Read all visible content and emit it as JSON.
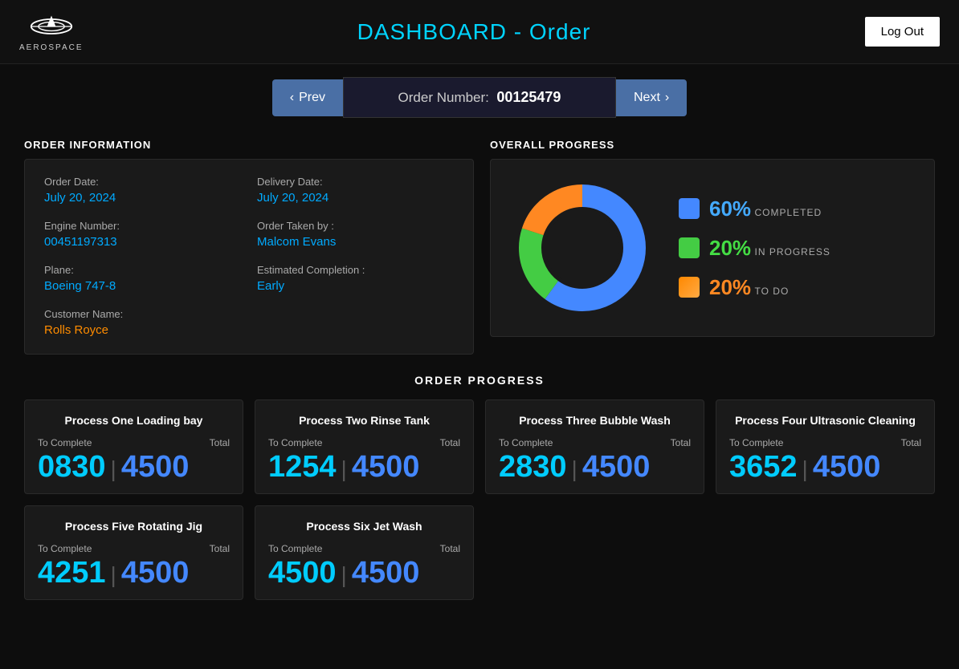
{
  "header": {
    "title": "DASHBOARD - Order",
    "logo_text": "AEROSPACE",
    "logout_label": "Log Out"
  },
  "nav": {
    "prev_label": "Prev",
    "next_label": "Next",
    "order_number_prefix": "Order Number:",
    "order_number": "00125479"
  },
  "order_info": {
    "section_title": "ORDER INFORMATION",
    "order_date_label": "Order Date:",
    "order_date_value": "July 20, 2024",
    "delivery_date_label": "Delivery Date:",
    "delivery_date_value": "July 20, 2024",
    "engine_number_label": "Engine Number:",
    "engine_number_value": "00451197313",
    "order_taken_label": "Order Taken by :",
    "order_taken_value": "Malcom Evans",
    "plane_label": "Plane:",
    "plane_value": "Boeing 747-8",
    "est_completion_label": "Estimated Completion :",
    "est_completion_value": "Early",
    "customer_label": "Customer Name:",
    "customer_value": "Rolls Royce"
  },
  "overall_progress": {
    "section_title": "OVERALL PROGRESS",
    "completed_pct": "60%",
    "completed_label": "COMPLETED",
    "in_progress_pct": "20%",
    "in_progress_label": "IN PROGRESS",
    "todo_pct": "20%",
    "todo_label": "TO DO",
    "donut": {
      "blue_deg": 216,
      "green_deg": 72,
      "orange_deg": 72
    }
  },
  "order_progress": {
    "section_title": "ORDER PROGRESS",
    "processes": [
      {
        "title": "Process One Loading bay",
        "to_complete": "0830",
        "total": "4500"
      },
      {
        "title": "Process Two Rinse Tank",
        "to_complete": "1254",
        "total": "4500"
      },
      {
        "title": "Process Three Bubble Wash",
        "to_complete": "2830",
        "total": "4500"
      },
      {
        "title": "Process Four Ultrasonic Cleaning",
        "to_complete": "3652",
        "total": "4500"
      },
      {
        "title": "Process Five Rotating Jig",
        "to_complete": "4251",
        "total": "4500"
      },
      {
        "title": "Process Six Jet Wash",
        "to_complete": "4500",
        "total": "4500"
      }
    ],
    "to_complete_label": "To Complete",
    "total_label": "Total"
  }
}
